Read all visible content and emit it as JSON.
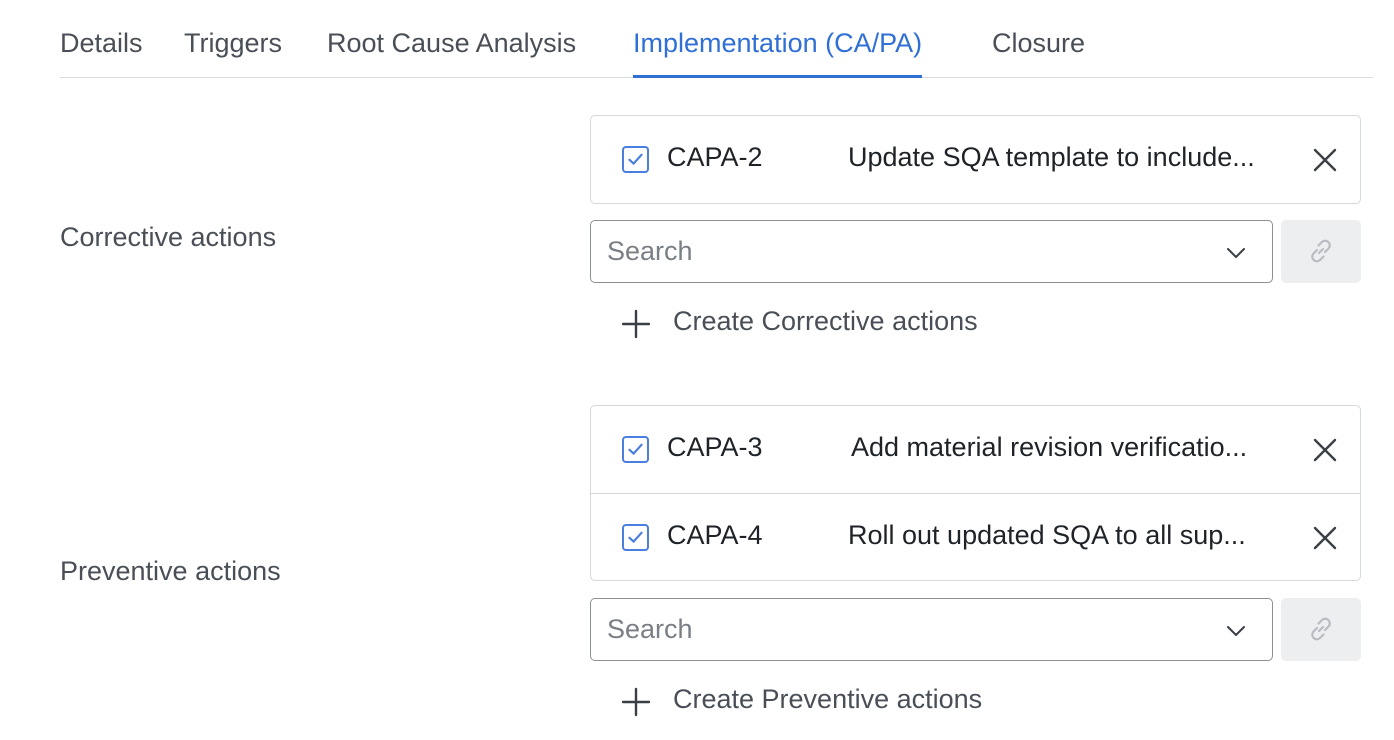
{
  "tabs": [
    {
      "label": "Details"
    },
    {
      "label": "Triggers"
    },
    {
      "label": "Root Cause Analysis"
    },
    {
      "label": "Implementation (CA/PA)",
      "active": true
    },
    {
      "label": "Closure"
    }
  ],
  "corrective": {
    "label": "Corrective actions",
    "items": [
      {
        "id": "CAPA-2",
        "title": "Update SQA template to include...",
        "checked": true
      }
    ],
    "search_placeholder": "Search",
    "create_label": "Create Corrective actions"
  },
  "preventive": {
    "label": "Preventive actions",
    "items": [
      {
        "id": "CAPA-3",
        "title": "Add material revision verificatio...",
        "checked": true
      },
      {
        "id": "CAPA-4",
        "title": "Roll out updated SQA to all sup...",
        "checked": true
      }
    ],
    "search_placeholder": "Search",
    "create_label": "Create Preventive actions"
  },
  "colors": {
    "accent": "#2f6fd6",
    "checkbox": "#4a7ee0",
    "label_text": "#4a4f57",
    "border": "#d6d8dc"
  },
  "icons": {
    "checkbox": "check-icon",
    "remove": "close-icon",
    "dropdown": "chevron-down-icon",
    "link": "link-icon",
    "create": "plus-icon"
  }
}
